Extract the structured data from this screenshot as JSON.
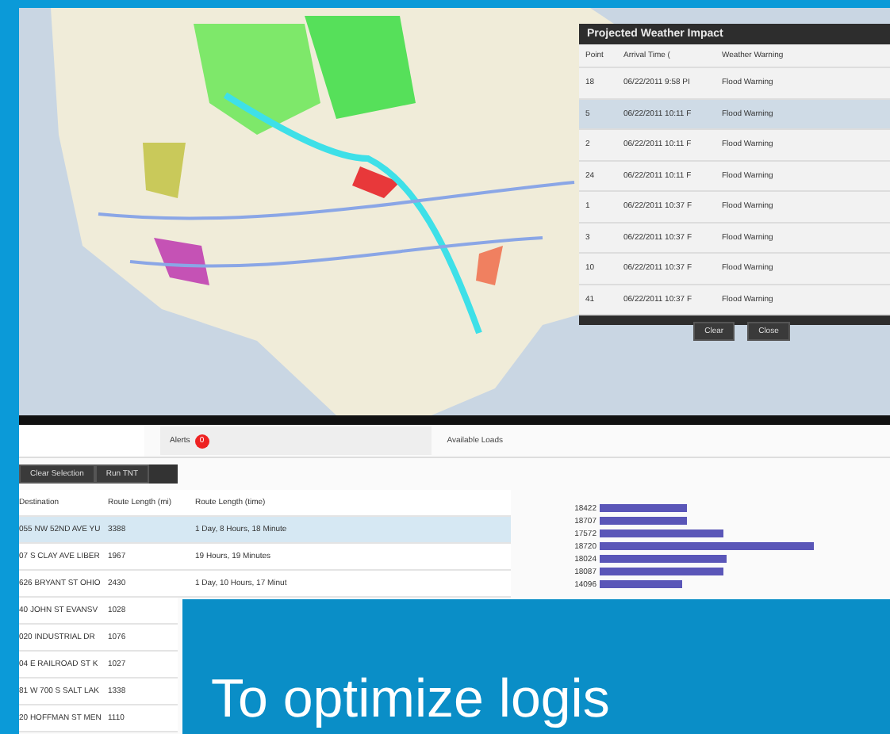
{
  "map": {
    "kind": "picture"
  },
  "weather_panel": {
    "title": "Projected Weather Impact",
    "columns": [
      "Point",
      "Arrival Time (",
      "Weather Warning"
    ],
    "rows": [
      {
        "cells": [
          "18",
          "06/22/2011 9:58 PI",
          "Flood Warning"
        ],
        "selected": false
      },
      {
        "cells": [
          "5",
          "06/22/2011 10:11 F",
          "Flood Warning"
        ],
        "selected": true
      },
      {
        "cells": [
          "2",
          "06/22/2011 10:11 F",
          "Flood Warning"
        ],
        "selected": false
      },
      {
        "cells": [
          "24",
          "06/22/2011 10:11 F",
          "Flood Warning"
        ],
        "selected": false
      },
      {
        "cells": [
          "1",
          "06/22/2011 10:37 F",
          "Flood Warning"
        ],
        "selected": false
      },
      {
        "cells": [
          "3",
          "06/22/2011 10:37 F",
          "Flood Warning"
        ],
        "selected": false
      },
      {
        "cells": [
          "10",
          "06/22/2011 10:37 F",
          "Flood Warning"
        ],
        "selected": false
      },
      {
        "cells": [
          "41",
          "06/22/2011 10:37 F",
          "Flood Warning"
        ],
        "selected": false
      }
    ],
    "buttons": [
      "Clear",
      "Close"
    ]
  },
  "alerts_tab": {
    "label": "Alerts",
    "badge": "0"
  },
  "loads_title": "Available Loads",
  "buttons": [
    "Clear Selection",
    "Run TNT"
  ],
  "routes": {
    "columns": [
      "Destination",
      "Route Length (mi)",
      "Route Length (time)"
    ],
    "rows": [
      {
        "cells": [
          "055 NW 52ND AVE YU",
          "3388",
          "1 Day, 8 Hours, 18 Minute"
        ],
        "selected": true
      },
      {
        "cells": [
          "07 S CLAY AVE LIBER",
          "1967",
          "19 Hours, 19 Minutes"
        ],
        "selected": false
      },
      {
        "cells": [
          "626 BRYANT ST OHIO",
          "2430",
          "1 Day, 10 Hours, 17 Minut"
        ],
        "selected": false
      },
      {
        "cells": [
          "40 JOHN ST EVANSV",
          "1028"
        ],
        "selected": false
      },
      {
        "cells": [
          "020 INDUSTRIAL DR",
          "1076"
        ],
        "selected": false
      },
      {
        "cells": [
          "04 E RAILROAD ST K",
          "1027"
        ],
        "selected": false
      },
      {
        "cells": [
          "81 W 700 S SALT LAK",
          "1338"
        ],
        "selected": false
      },
      {
        "cells": [
          "20 HOFFMAN ST MEN",
          "1110"
        ],
        "selected": false
      }
    ]
  },
  "load_labels": [
    "18422",
    "18707",
    "17572",
    "18720",
    "18024",
    "18087",
    "14096"
  ],
  "caption": "To optimize logis"
}
